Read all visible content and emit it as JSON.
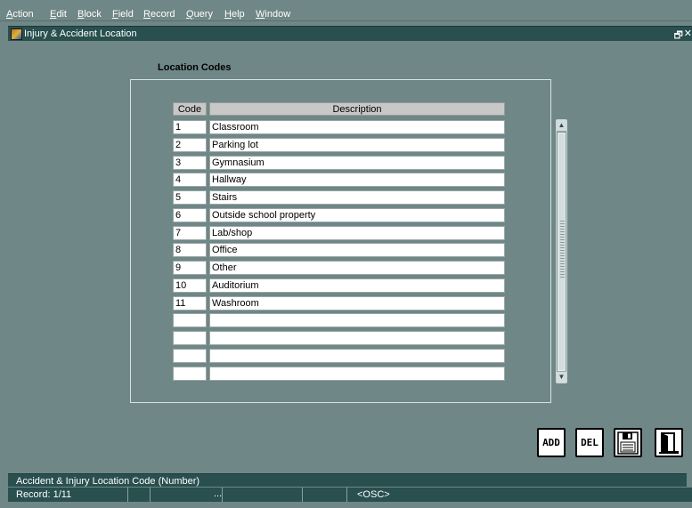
{
  "menu": [
    "Action",
    "Edit",
    "Block",
    "Field",
    "Record",
    "Query",
    "Help",
    "Window"
  ],
  "window": {
    "title": "Injury & Accident Location",
    "restore_glyph": "🗗",
    "close_glyph": "✕"
  },
  "form": {
    "section_title": "Location Codes",
    "columns": {
      "code": "Code",
      "description": "Description"
    },
    "rows": [
      {
        "code": "1",
        "description": "Classroom"
      },
      {
        "code": "2",
        "description": "Parking lot"
      },
      {
        "code": "3",
        "description": "Gymnasium"
      },
      {
        "code": "4",
        "description": "Hallway"
      },
      {
        "code": "5",
        "description": "Stairs"
      },
      {
        "code": "6",
        "description": "Outside school property"
      },
      {
        "code": "7",
        "description": "Lab/shop"
      },
      {
        "code": "8",
        "description": "Office"
      },
      {
        "code": "9",
        "description": "Other"
      },
      {
        "code": "10",
        "description": "Auditorium"
      },
      {
        "code": "11",
        "description": "Washroom"
      },
      {
        "code": "",
        "description": ""
      },
      {
        "code": "",
        "description": ""
      },
      {
        "code": "",
        "description": ""
      },
      {
        "code": "",
        "description": ""
      }
    ]
  },
  "buttons": {
    "add": "ADD",
    "del": "DEL",
    "save_icon": "floppy-disk-icon",
    "exit_icon": "door-exit-icon"
  },
  "status": {
    "hint": "Accident & Injury Location Code (Number)",
    "record": "Record: 1/11",
    "dots": "...",
    "mode": "<OSC>"
  },
  "colors": {
    "background": "#6f8786",
    "titlebar": "#294f4f",
    "header_cell": "#c8c8c8"
  }
}
